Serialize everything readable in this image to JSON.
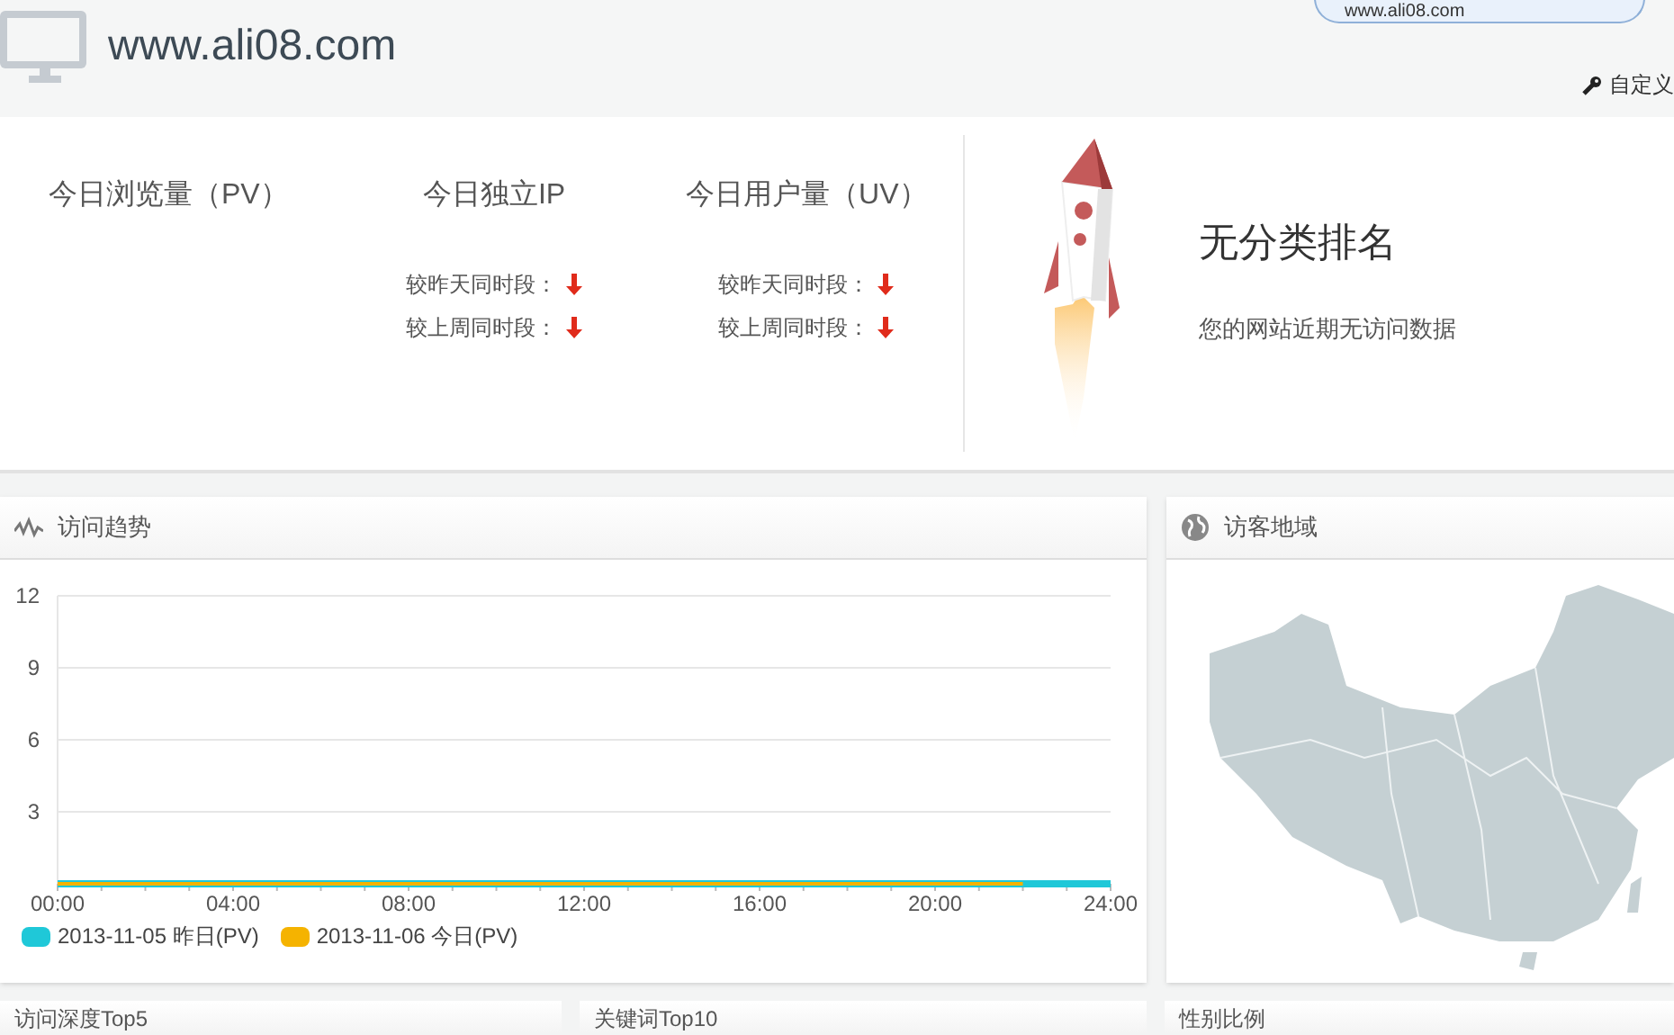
{
  "header": {
    "site": "www.ali08.com",
    "site_field": {
      "value": "www.ali08.com"
    },
    "customize": "自定义"
  },
  "stats": [
    {
      "label": "今日浏览量（PV）"
    },
    {
      "label": "今日独立IP",
      "comparisons": [
        {
          "label": "较昨天同时段：",
          "kind": "down"
        },
        {
          "label": "较上周同时段：",
          "kind": "down"
        }
      ]
    },
    {
      "label": "今日用户量（UV）",
      "comparisons": [
        {
          "label": "较昨天同时段：",
          "kind": "down"
        },
        {
          "label": "较上周同时段：",
          "kind": "down"
        }
      ]
    }
  ],
  "ranking": {
    "title": "无分类排名",
    "message": "您的网站近期无访问数据"
  },
  "trend_panel": {
    "title": "访问趋势",
    "chart_data": {
      "type": "line",
      "x": [
        0,
        1,
        2,
        3,
        4,
        5,
        6,
        7,
        8,
        9,
        10,
        11,
        12,
        13,
        14,
        15,
        16,
        17,
        18,
        19,
        20,
        21,
        22,
        23,
        24
      ],
      "xticks": [
        {
          "value": 0,
          "label": "00:00"
        },
        {
          "value": 4,
          "label": "04:00"
        },
        {
          "value": 8,
          "label": "08:00"
        },
        {
          "value": 12,
          "label": "12:00"
        },
        {
          "value": 16,
          "label": "16:00"
        },
        {
          "value": 20,
          "label": "20:00"
        },
        {
          "value": 24,
          "label": "24:00"
        }
      ],
      "yticks": [
        3,
        6,
        9,
        12
      ],
      "ylim": [
        0,
        12
      ],
      "xlim": [
        0,
        24
      ],
      "grid": true,
      "legend": "bottom",
      "series": [
        {
          "name": "2013-11-05 昨日(PV)",
          "color": "#1fc8d8",
          "values": [
            0,
            0,
            0,
            0,
            0,
            0,
            0,
            0,
            0,
            0,
            0,
            0,
            0,
            0,
            0,
            0,
            0,
            0,
            0,
            0,
            0,
            0,
            0,
            0,
            0
          ]
        },
        {
          "name": "2013-11-06 今日(PV)",
          "color": "#f5b300",
          "values": [
            0,
            0,
            0,
            0,
            0,
            0,
            0,
            0,
            0,
            0,
            0,
            0,
            0,
            0,
            0,
            0,
            0,
            0,
            0,
            0,
            0,
            0,
            0,
            null,
            null
          ]
        }
      ]
    }
  },
  "region_panel": {
    "title": "访客地域"
  },
  "bottom_panels": [
    {
      "title": "访问深度Top5"
    },
    {
      "title": "关键词Top10"
    },
    {
      "title": "性别比例"
    }
  ]
}
